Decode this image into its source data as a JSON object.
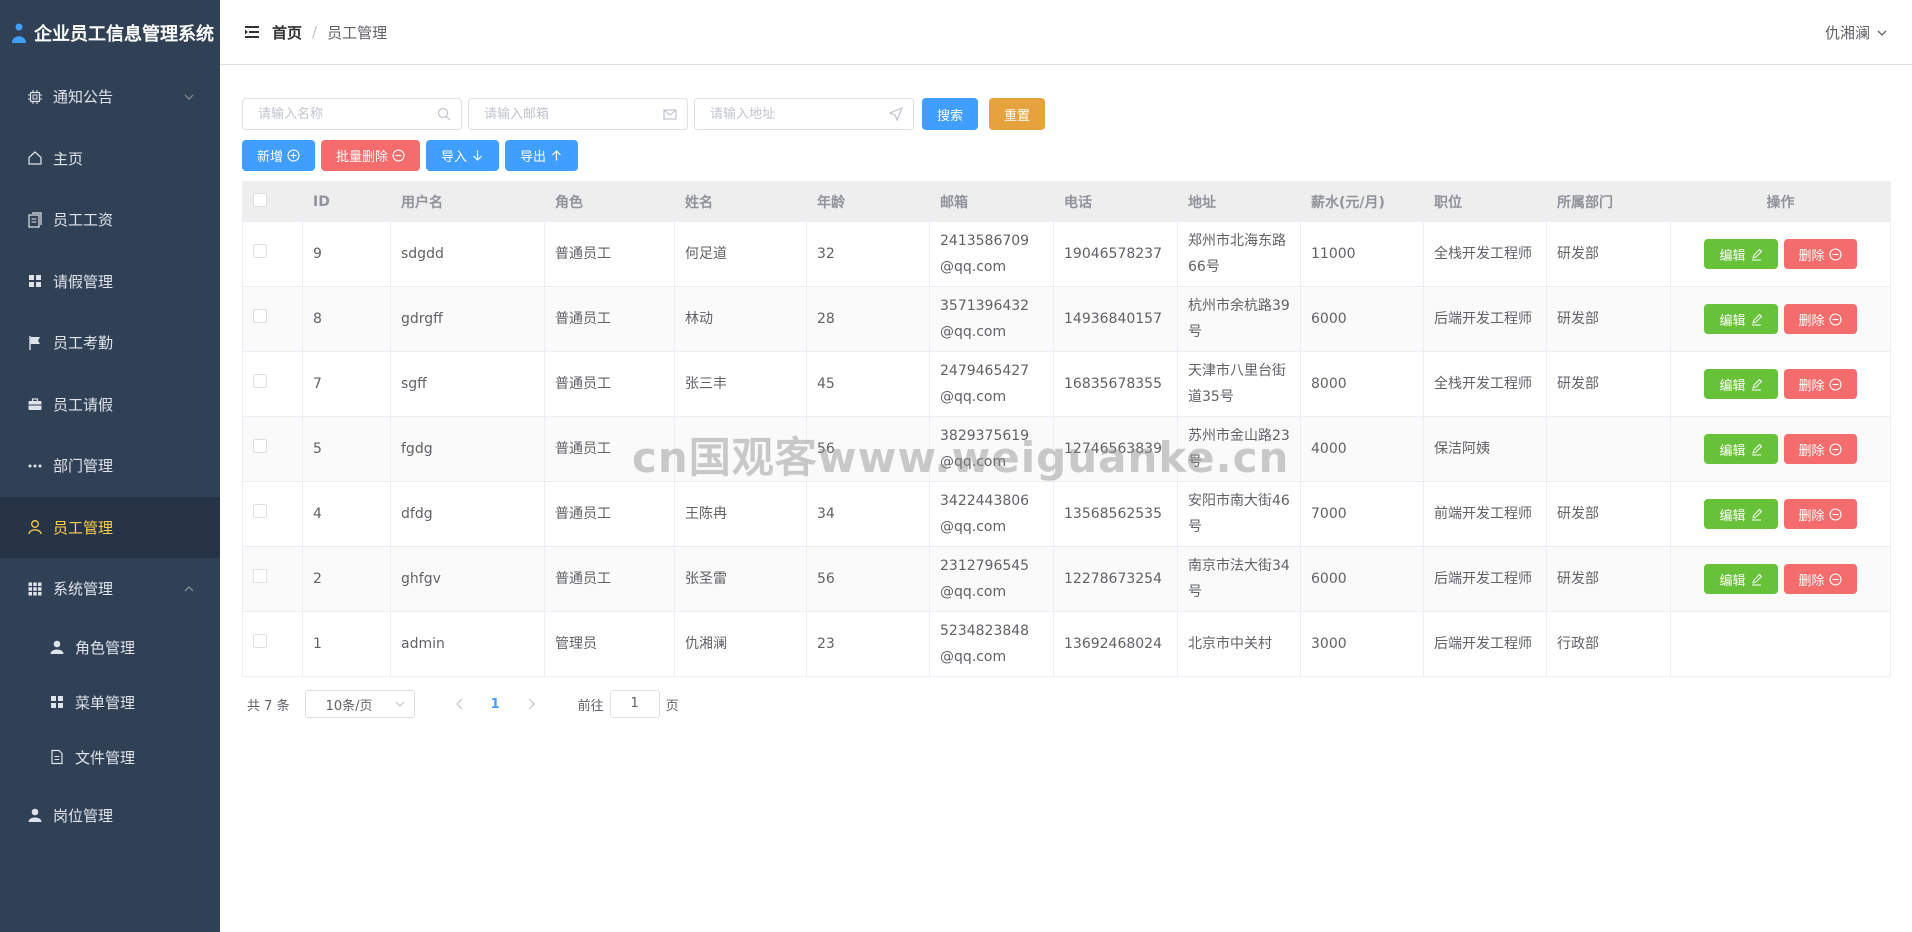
{
  "app": {
    "title": "企业员工信息管理系统"
  },
  "sidebar": {
    "items": [
      {
        "label": "通知公告",
        "icon": "cpu-icon",
        "expandable": true,
        "expanded": false
      },
      {
        "label": "主页",
        "icon": "home-icon"
      },
      {
        "label": "员工工资",
        "icon": "documents-icon"
      },
      {
        "label": "请假管理",
        "icon": "grid-icon"
      },
      {
        "label": "员工考勤",
        "icon": "flag-icon"
      },
      {
        "label": "员工请假",
        "icon": "briefcase-icon"
      },
      {
        "label": "部门管理",
        "icon": "more-icon"
      },
      {
        "label": "员工管理",
        "icon": "user-icon",
        "active": true
      },
      {
        "label": "系统管理",
        "icon": "menu-grid-icon",
        "expandable": true,
        "expanded": true
      }
    ],
    "sub_items": [
      {
        "label": "角色管理",
        "icon": "user-solid-icon"
      },
      {
        "label": "菜单管理",
        "icon": "grid-icon"
      },
      {
        "label": "文件管理",
        "icon": "document-icon"
      }
    ],
    "last_item": {
      "label": "岗位管理",
      "icon": "user-solid-icon"
    }
  },
  "header": {
    "breadcrumb_home": "首页",
    "breadcrumb_sep": "/",
    "breadcrumb_current": "员工管理",
    "user_name": "仇湘澜"
  },
  "search": {
    "name_placeholder": "请输入名称",
    "email_placeholder": "请输入邮箱",
    "address_placeholder": "请输入地址",
    "search_label": "搜索",
    "reset_label": "重置"
  },
  "actions": {
    "add_label": "新增",
    "batch_delete_label": "批量删除",
    "import_label": "导入",
    "export_label": "导出"
  },
  "table": {
    "columns": [
      "ID",
      "用户名",
      "角色",
      "姓名",
      "年龄",
      "邮箱",
      "电话",
      "地址",
      "薪水(元/月)",
      "职位",
      "所属部门",
      "操作"
    ],
    "edit_label": "编辑",
    "delete_label": "删除",
    "rows": [
      {
        "id": "9",
        "username": "sdgdd",
        "role": "普通员工",
        "name": "何足道",
        "age": "32",
        "email": "2413586709@qq.com",
        "phone": "19046578237",
        "address": "郑州市北海东路66号",
        "salary": "11000",
        "position": "全栈开发工程师",
        "dept": "研发部",
        "ops": true
      },
      {
        "id": "8",
        "username": "gdrgff",
        "role": "普通员工",
        "name": "林动",
        "age": "28",
        "email": "3571396432@qq.com",
        "phone": "14936840157",
        "address": "杭州市余杭路39号",
        "salary": "6000",
        "position": "后端开发工程师",
        "dept": "研发部",
        "ops": true
      },
      {
        "id": "7",
        "username": "sgff",
        "role": "普通员工",
        "name": "张三丰",
        "age": "45",
        "email": "2479465427@qq.com",
        "phone": "16835678355",
        "address": "天津市八里台街道35号",
        "salary": "8000",
        "position": "全栈开发工程师",
        "dept": "研发部",
        "ops": true
      },
      {
        "id": "5",
        "username": "fgdg",
        "role": "普通员工",
        "name": "",
        "age": "56",
        "email": "3829375619@qq.com",
        "phone": "12746563839",
        "address": "苏州市金山路23号",
        "salary": "4000",
        "position": "保洁阿姨",
        "dept": "",
        "ops": true
      },
      {
        "id": "4",
        "username": "dfdg",
        "role": "普通员工",
        "name": "王陈冉",
        "age": "34",
        "email": "3422443806@qq.com",
        "phone": "13568562535",
        "address": "安阳市南大街46号",
        "salary": "7000",
        "position": "前端开发工程师",
        "dept": "研发部",
        "ops": true
      },
      {
        "id": "2",
        "username": "ghfgv",
        "role": "普通员工",
        "name": "张圣雷",
        "age": "56",
        "email": "2312796545@qq.com",
        "phone": "12278673254",
        "address": "南京市法大街34号",
        "salary": "6000",
        "position": "后端开发工程师",
        "dept": "研发部",
        "ops": true
      },
      {
        "id": "1",
        "username": "admin",
        "role": "管理员",
        "name": "仇湘澜",
        "age": "23",
        "email": "5234823848@qq.com",
        "phone": "13692468024",
        "address": "北京市中关村",
        "salary": "3000",
        "position": "后端开发工程师",
        "dept": "行政部",
        "ops": false
      }
    ]
  },
  "pagination": {
    "total_prefix": "共",
    "total": "7",
    "total_suffix": "条",
    "page_size": "10条/页",
    "current_page": "1",
    "jump_prefix": "前往",
    "jump_value": "1",
    "jump_suffix": "页"
  },
  "watermark": "cn国观客www.weiguanke.cn",
  "colors": {
    "sidebar_bg": "#304156",
    "active_text": "#ffd04b",
    "primary": "#409eff",
    "warning": "#e6a23c",
    "danger": "#f56c6c",
    "success": "#67c23a"
  }
}
